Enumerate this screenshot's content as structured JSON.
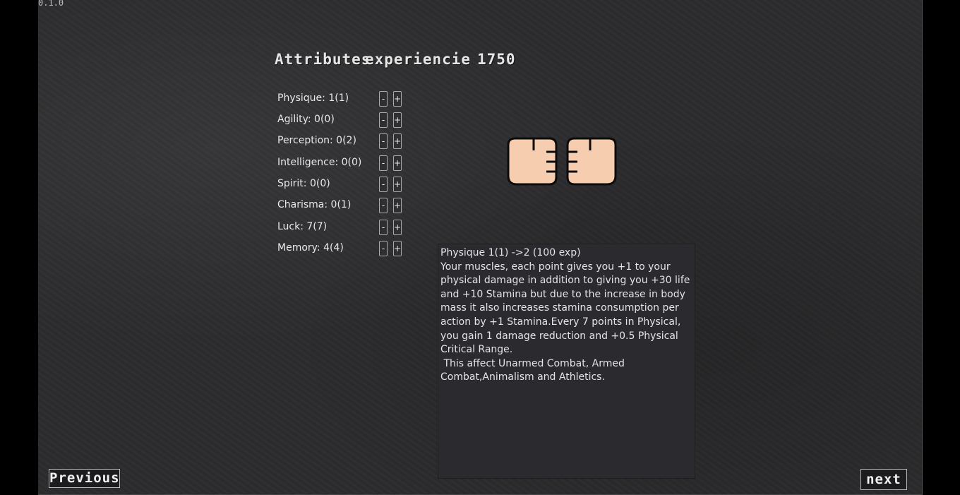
{
  "version": "0.1.0",
  "header": {
    "title": "Attributes",
    "experience_label": "experiencie",
    "experience_value": "1750"
  },
  "attributes": [
    {
      "label": "Physique: 1(1)",
      "minus": "-",
      "plus": "+"
    },
    {
      "label": "Agility: 0(0)",
      "minus": "-",
      "plus": "+"
    },
    {
      "label": "Perception: 0(2)",
      "minus": "-",
      "plus": "+"
    },
    {
      "label": "Intelligence: 0(0)",
      "minus": "-",
      "plus": "+"
    },
    {
      "label": "Spirit: 0(0)",
      "minus": "-",
      "plus": "+"
    },
    {
      "label": "Charisma: 0(1)",
      "minus": "-",
      "plus": "+"
    },
    {
      "label": "Luck: 7(7)",
      "minus": "-",
      "plus": "+"
    },
    {
      "label": "Memory: 4(4)",
      "minus": "-",
      "plus": "+"
    }
  ],
  "icon": "fists-icon",
  "description": "Physique 1(1) ->2 (100 exp)\nYour muscles, each point gives you +1 to your physical damage in addition to giving you +30 life and +10 Stamina but due to the increase in body mass it also increases stamina consumption per action by +1 Stamina.Every 7 points in Physical, you gain 1 damage reduction and +0.5 Physical Critical Range.\n This affect Unarmed Combat, Armed Combat,Animalism and Athletics.",
  "nav": {
    "previous": "Previous",
    "next": "next"
  },
  "colors": {
    "background": "#2c2c2e",
    "skin": "#f7cdb0",
    "text": "#e8e8e8"
  }
}
